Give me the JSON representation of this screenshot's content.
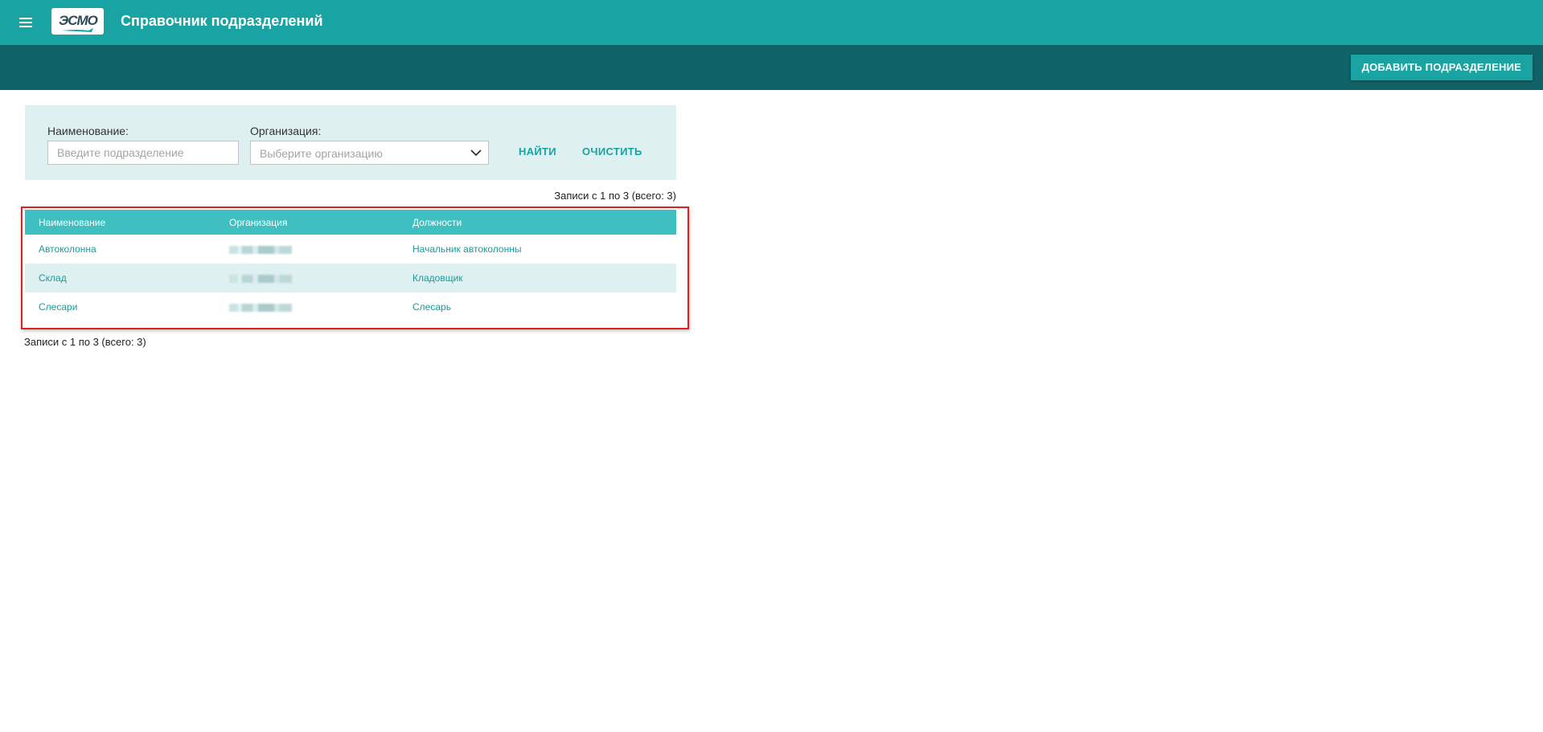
{
  "header": {
    "logo_text": "ЭСМО",
    "title": "Справочник подразделений",
    "menu_icon": "hamburger-menu-icon",
    "bg_color": "#1aa3a3"
  },
  "toolbar": {
    "add_button_label": "ДОБАВИТЬ ПОДРАЗДЕЛЕНИЕ",
    "bg_color": "#106366"
  },
  "filters": {
    "name_label": "Наименование:",
    "name_placeholder": "Введите подразделение",
    "name_value": "",
    "org_label": "Организация:",
    "org_placeholder": "Выберите организацию",
    "find_label": "НАЙТИ",
    "clear_label": "ОЧИСТИТЬ"
  },
  "records_info": "Записи с 1 по 3 (всего: 3)",
  "table": {
    "columns": [
      "Наименование",
      "Организация",
      "Должности"
    ],
    "rows": [
      {
        "name": "Автоколонна",
        "org": "",
        "position": "Начальник автоколонны"
      },
      {
        "name": "Склад",
        "org": "",
        "position": "Кладовщик"
      },
      {
        "name": "Слесари",
        "org": "",
        "position": "Слесарь"
      }
    ],
    "header_color": "#3fbfbf",
    "highlight_color": "#e02020"
  }
}
